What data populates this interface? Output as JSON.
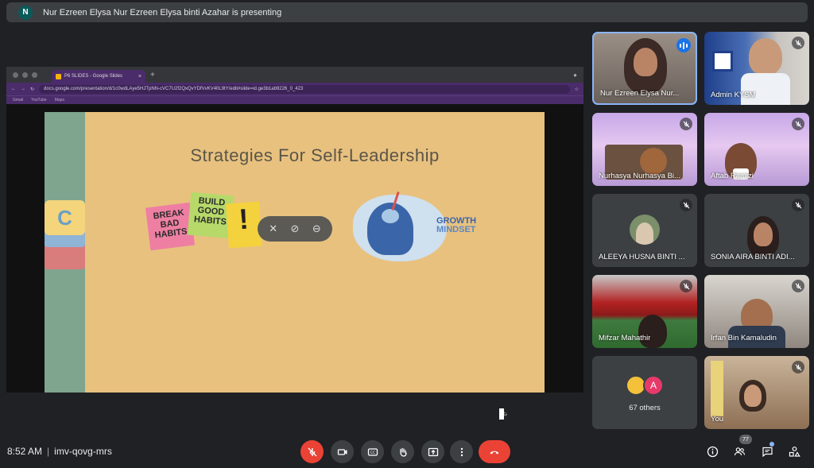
{
  "banner": {
    "avatar_letter": "N",
    "text": "Nur Ezreen Elysa Nur Ezreen Elysa binti Azahar is presenting"
  },
  "browser": {
    "tab_title": "P6 SLIDES - Google Slides",
    "tab_close": "×",
    "new_tab": "+",
    "url": "docs.google.com/presentation/d/1c0wdLAye5HJTpNN-cVC7U2f2QxQvYDfVvKV40L9tY/edit#slide=id.ge3b1ab9226_0_423",
    "bookmarks": [
      "Gmail",
      "YouTube",
      "Maps"
    ]
  },
  "slide": {
    "title": "Strategies For Self-Leadership",
    "tab_letter": "C",
    "note1": "BREAK BAD HABITS",
    "note2": "BUILD GOOD HABITS",
    "note3": "!",
    "growth_line1": "GROWTH",
    "growth_line2": "MINDSET"
  },
  "tiles": [
    {
      "name": "Nur Ezreen Elysa Nur..."
    },
    {
      "name": "Admin KYSM"
    },
    {
      "name": "Nurhasya Nurhasya Bi..."
    },
    {
      "name": "Aftab Ramizi"
    },
    {
      "name": "ALEEYA HUSNA BINTI ..."
    },
    {
      "name": "SONIA AIRA BINTI ADI..."
    },
    {
      "name": "Mifzar Mahathir"
    },
    {
      "name": "Irfan Bin Kamaludin"
    },
    {
      "name": "67 others",
      "avatar_letter": "A"
    },
    {
      "name": "You"
    }
  ],
  "bottom": {
    "time": "8:52 AM",
    "separator": "|",
    "meeting_code": "imv-qovg-mrs",
    "participants_count": "77"
  },
  "colors": {
    "end_call": "#ea4335",
    "mic_off": "#ea4335",
    "accent": "#8ab4f8"
  }
}
